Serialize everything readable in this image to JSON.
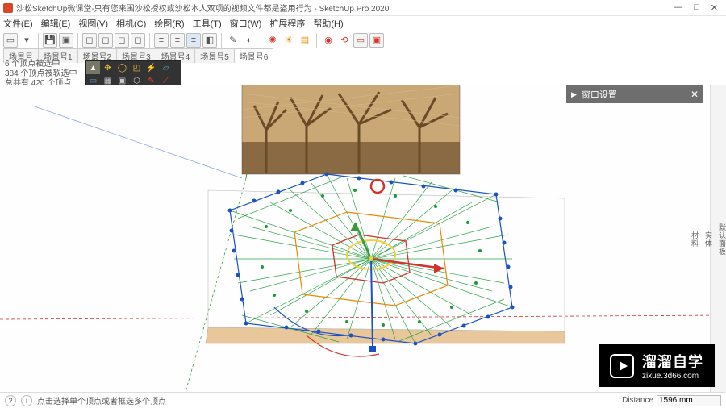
{
  "titlebar": {
    "text": "沙松SketchUp微课堂-只有您来围沙松授权或沙松本人双项的视频文件都是盗用行为 - SketchUp Pro 2020"
  },
  "win_controls": {
    "min": "—",
    "max": "□",
    "close": "✕"
  },
  "menu": {
    "file": "文件(E)",
    "edit": "编辑(E)",
    "view": "视图(V)",
    "camera": "相机(C)",
    "draw": "绘图(R)",
    "tools": "工具(T)",
    "window": "窗口(W)",
    "ext": "扩展程序",
    "help": "帮助(H)"
  },
  "toolbar": {
    "newdoc": "▭",
    "save": "💾",
    "cube": "▣",
    "r1": "◻",
    "r2": "◻",
    "r3": "◻",
    "r4": "◻",
    "align1": "≡",
    "align2": "≡",
    "align3": "≡",
    "colors": "◧",
    "pencil": "✎",
    "bulb": "◐",
    "gear": "✺",
    "sun": "☀",
    "layers": "▤",
    "rec": "◉",
    "cam1": "⟲",
    "cam2": "▭",
    "cam3": "▣"
  },
  "scenes": {
    "s0": "场景号",
    "s1": "场景号1",
    "s2": "场景号2",
    "s3": "场景号3",
    "s4": "场景号4",
    "s5": "场景号5",
    "active": "场景号6"
  },
  "info": {
    "line1": "6 个顶点被选中",
    "line2": "384 个顶点被软选中",
    "line3": "总共有 420 个顶点"
  },
  "right_panel": {
    "title": "窗口设置",
    "close": "✕",
    "chev": "▶"
  },
  "right_rail": {
    "r1": "默认面板",
    "r2": "实体",
    "r3": "材料"
  },
  "status": {
    "hint": "点击选择单个顶点或者框选多个顶点",
    "vcb_label": "Distance",
    "vcb_value": "1596 mm"
  },
  "watermark": {
    "brand": "溜溜自学",
    "url": "zixue.3d66.com"
  },
  "chart_data": {
    "type": "other",
    "description": "3D viewport: angled ground plane with a hexagonal flat grid pattern (concentric hex rings + triangulated mesh) with colored control points (outer blue dots, inner green/orange/red rings) centered on a move-gizmo (red/green/blue axes). An orange slab rectangle sits beneath. A reference architectural photo plane stands vertically behind. Red dashed horizon line, green vertical axis line, faint blue axis."
  }
}
